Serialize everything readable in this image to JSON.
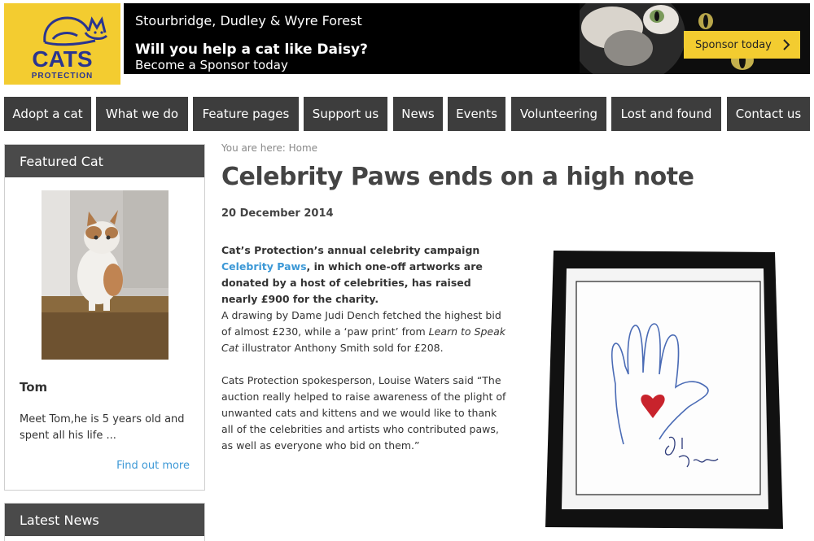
{
  "logo": {
    "word": "CATS",
    "sub": "PROTECTION"
  },
  "banner": {
    "location": "Stourbridge, Dudley & Wyre Forest",
    "headline": "Will you help a cat like Daisy?",
    "subline": "Become a Sponsor today",
    "button": "Sponsor today"
  },
  "nav": [
    {
      "label": "Adopt a cat"
    },
    {
      "label": "What we do"
    },
    {
      "label": "Feature pages"
    },
    {
      "label": "Support us"
    },
    {
      "label": "News"
    },
    {
      "label": "Events"
    },
    {
      "label": "Volunteering"
    },
    {
      "label": "Lost and found"
    },
    {
      "label": "Contact us"
    }
  ],
  "sidebar": {
    "featured_title": "Featured Cat",
    "cat_name": "Tom",
    "cat_desc": "Meet Tom,he is 5 years old and spent all his life ...",
    "find_more": "Find out more",
    "latest_title": "Latest News"
  },
  "main": {
    "breadcrumb": "You are here: Home",
    "title": "Celebrity Paws ends on a high note",
    "date": "20 December 2014",
    "lead_before": "Cat’s Protection’s annual celebrity campaign ",
    "lead_link": "Celebrity Paws",
    "lead_after": ", in which one-off artworks are donated by a host of celebrities, has raised nearly £900 for the charity.",
    "para1_a": "A drawing by Dame Judi Dench fetched the highest bid of almost £230, while a ‘paw print’ from ",
    "para1_em": "Learn to Speak Cat",
    "para1_b": " illustrator Anthony Smith sold for £208.",
    "para2": "Cats Protection spokesperson, Louise Waters said “The auction really helped to raise awareness of the plight of unwanted cats and kittens and we would like to thank all of the celebrities and artists who contributed paws, as well as everyone who bid on them.”"
  },
  "colors": {
    "brand_yellow": "#f3cc30",
    "brand_blue": "#2a3590",
    "nav_bg": "#3d3d3d",
    "link": "#3c98d6"
  }
}
